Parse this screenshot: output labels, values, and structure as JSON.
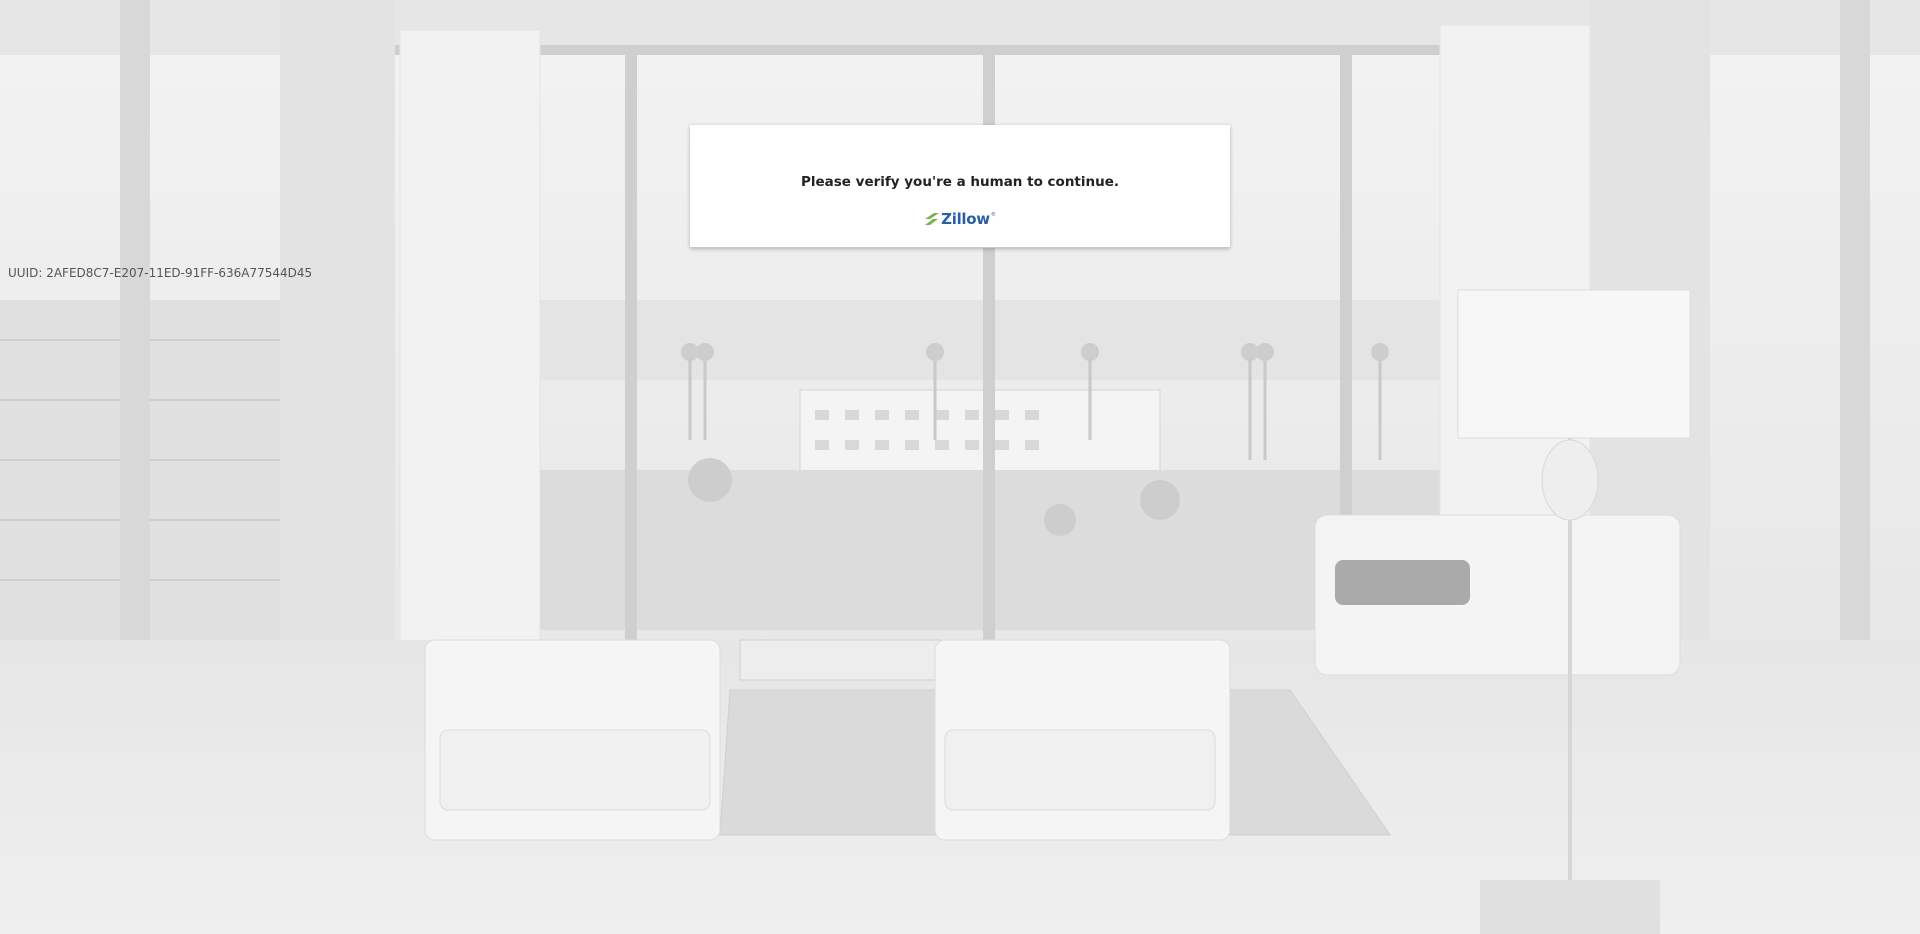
{
  "page": {
    "uuid_text": "UUID: 2AFED8C7-E207-11ED-91FF-636A77544D45"
  },
  "modal": {
    "title": "Please verify you're a human to continue.",
    "brand": "Zillow",
    "brand_mark": "zillow-logo-icon"
  },
  "colors": {
    "background": "#ececec",
    "modal_bg": "#ffffff",
    "brand_blue": "#2a5fa8",
    "brand_green": "#7bb24b"
  }
}
